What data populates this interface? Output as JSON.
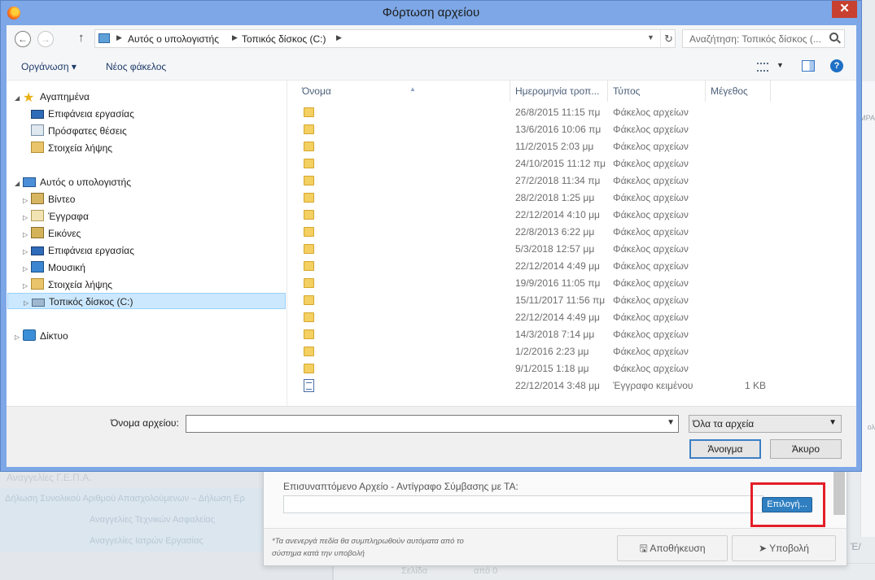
{
  "dialog": {
    "title": "Φόρτωση αρχείου",
    "close_glyph": "✕",
    "address": {
      "crumbs": [
        "Αυτός ο υπολογιστής",
        "Τοπικός δίσκος (C:)"
      ],
      "search_placeholder": "Αναζήτηση: Τοπικός δίσκος (..."
    },
    "toolbar": {
      "organize_label": "Οργάνωση ▾",
      "new_folder_label": "Νέος φάκελος"
    },
    "navpane": {
      "favorites": "Αγαπημένα",
      "favorites_items": [
        "Επιφάνεια εργασίας",
        "Πρόσφατες θέσεις",
        "Στοιχεία λήψης"
      ],
      "this_pc": "Αυτός ο υπολογιστής",
      "pc_items": [
        "Βίντεο",
        "Έγγραφα",
        "Εικόνες",
        "Επιφάνεια εργασίας",
        "Μουσική",
        "Στοιχεία λήψης",
        "Τοπικός δίσκος (C:)"
      ],
      "network": "Δίκτυο"
    },
    "columns": [
      "Όνομα",
      "Ημερομηνία τροπ...",
      "Τύπος",
      "Μέγεθος"
    ],
    "files": [
      {
        "date": "26/8/2015 11:15 πμ",
        "type": "Φάκελος αρχείων",
        "size": ""
      },
      {
        "date": "13/6/2016 10:06 πμ",
        "type": "Φάκελος αρχείων",
        "size": ""
      },
      {
        "date": "11/2/2015 2:03 μμ",
        "type": "Φάκελος αρχείων",
        "size": ""
      },
      {
        "date": "24/10/2015 11:12 πμ",
        "type": "Φάκελος αρχείων",
        "size": ""
      },
      {
        "date": "27/2/2018 11:34 πμ",
        "type": "Φάκελος αρχείων",
        "size": ""
      },
      {
        "date": "28/2/2018 1:25 μμ",
        "type": "Φάκελος αρχείων",
        "size": ""
      },
      {
        "date": "22/12/2014 4:10 μμ",
        "type": "Φάκελος αρχείων",
        "size": ""
      },
      {
        "date": "22/8/2013 6:22 μμ",
        "type": "Φάκελος αρχείων",
        "size": ""
      },
      {
        "date": "5/3/2018 12:57 μμ",
        "type": "Φάκελος αρχείων",
        "size": ""
      },
      {
        "date": "22/12/2014 4:49 μμ",
        "type": "Φάκελος αρχείων",
        "size": ""
      },
      {
        "date": "19/9/2016 11:05 πμ",
        "type": "Φάκελος αρχείων",
        "size": ""
      },
      {
        "date": "15/11/2017 11:56 πμ",
        "type": "Φάκελος αρχείων",
        "size": ""
      },
      {
        "date": "22/12/2014 4:49 μμ",
        "type": "Φάκελος αρχείων",
        "size": ""
      },
      {
        "date": "14/3/2018 7:14 μμ",
        "type": "Φάκελος αρχείων",
        "size": ""
      },
      {
        "date": "1/2/2016 2:23 μμ",
        "type": "Φάκελος αρχείων",
        "size": ""
      },
      {
        "date": "9/1/2015 1:18 μμ",
        "type": "Φάκελος αρχείων",
        "size": ""
      },
      {
        "date": "22/12/2014 3:48 μμ",
        "type": "Έγγραφο κειμένου",
        "size": "1 KB"
      }
    ],
    "bottom": {
      "filename_label": "Όνομα αρχείου:",
      "filename_value": "",
      "filter_value": "Όλα τα αρχεία",
      "open_label": "Άνοιγμα",
      "cancel_label": "Άκυρο"
    }
  },
  "background": {
    "section_title": "Αναγγελίες Γ.Ε.Π.Α.",
    "nav_items": [
      "Δήλωση Συνολικού Αριθμού Απασχολούμενων – Δήλωση Ερ",
      "Αναγγελίες Τεχνικών Ασφαλείας",
      "Αναγγελίες Ιατρών Εργασίας"
    ],
    "attach_label": "Επισυναπτόμενο Αρχείο - Αντίγραφο Σύμβασης με ΤΑ:",
    "choose_label": "Επιλογή...",
    "note": "*Τα ανενεργά πεδία θα συμπληρωθούν αυτόματα από το σύστημα κατά την υποβολή",
    "save_label": "Αποθήκευση",
    "submit_label": "Υποβολή",
    "pager_page": "Σελίδα",
    "pager_of": "από 0",
    "right_frag_1": "ΜΡΑ",
    "right_frag_2": "ολ",
    "radio_frag": "Έ/"
  }
}
